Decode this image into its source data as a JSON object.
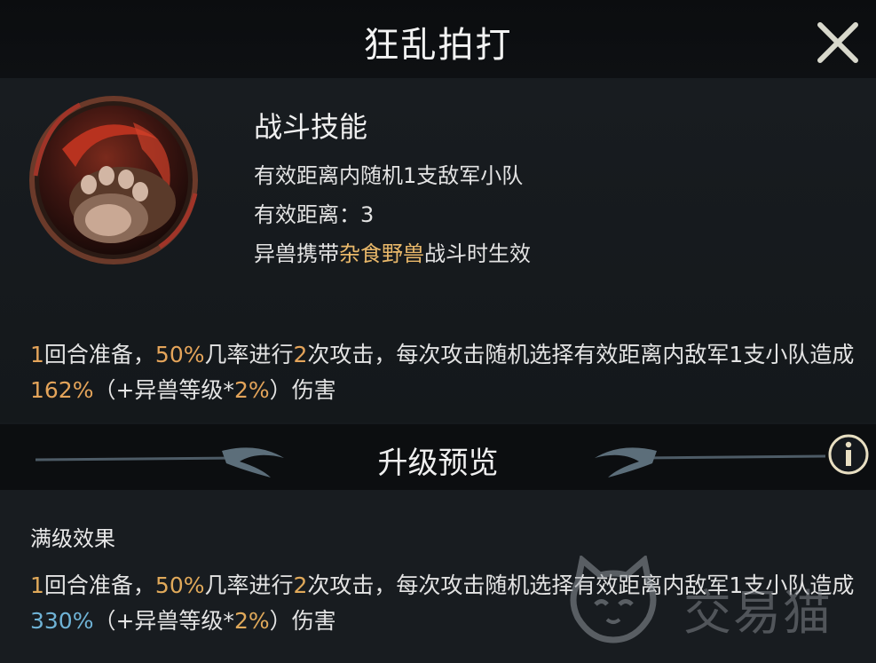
{
  "header": {
    "title": "狂乱拍打"
  },
  "skill": {
    "type": "战斗技能",
    "target": "有效距离内随机1支敌军小队",
    "range": "有效距离：3",
    "condition_prefix": "异兽携带",
    "condition_highlight": "杂食野兽",
    "condition_suffix": "战斗时生效"
  },
  "description": {
    "parts": {
      "n1": "1",
      "t1": "回合准备，",
      "n2": "50%",
      "t2": "几率进行",
      "n3": "2",
      "t3": "次攻击，每次攻击随机选择有效距离内敌军1支小队造成",
      "n4": "162%",
      "t4": "（+异兽等级*",
      "n5": "2%",
      "t5": "）伤害"
    }
  },
  "upgrade": {
    "title": "升级预览"
  },
  "full_level": {
    "title": "满级效果",
    "parts": {
      "n1": "1",
      "t1": "回合准备，",
      "n2": "50%",
      "t2": "几率进行",
      "n3": "2",
      "t3": "次攻击，每次攻击随机选择有效距离内敌军1支小队造成",
      "n4": "330%",
      "t4": "（+异兽等级*",
      "n5": "2%",
      "t5": "）伤害"
    }
  },
  "watermark": {
    "text": "交易猫"
  },
  "colors": {
    "accent_gold": "#e9b86a",
    "number_orange": "#e4a45a",
    "number_blue": "#6fb3d6"
  }
}
